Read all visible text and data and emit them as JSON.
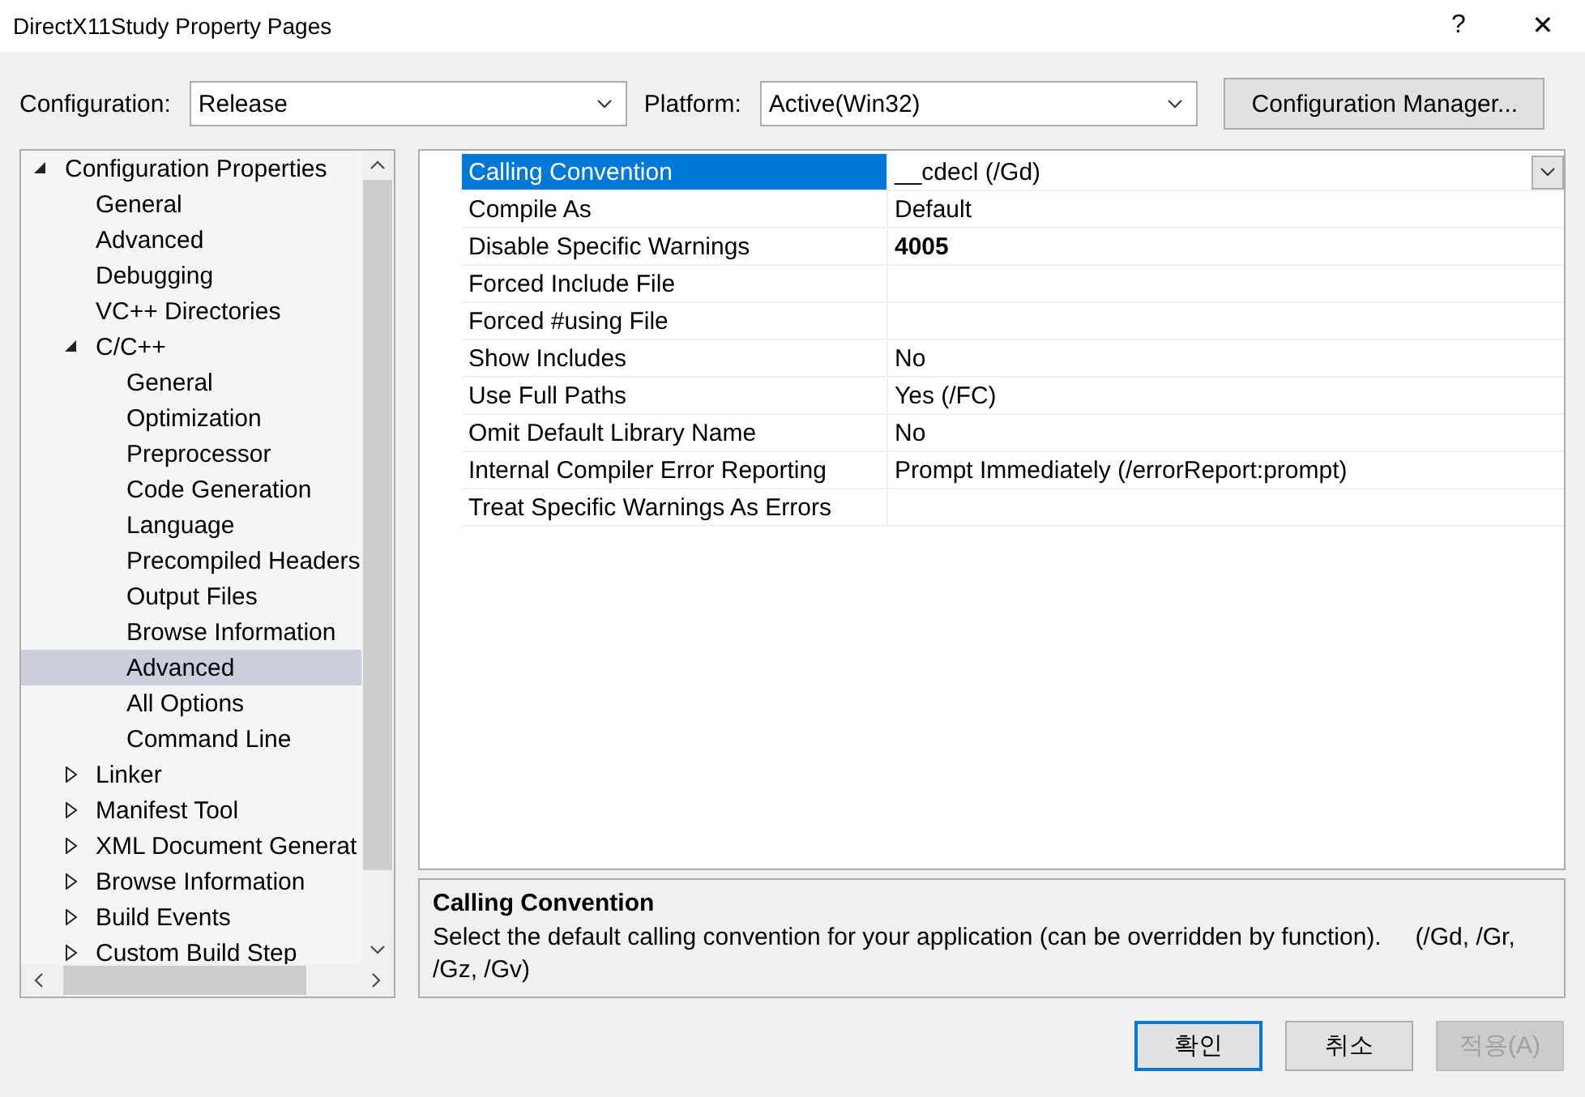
{
  "window": {
    "title": "DirectX11Study Property Pages",
    "help": "?",
    "close": "✕"
  },
  "toolbar": {
    "configuration_label": "Configuration:",
    "configuration": "Release",
    "platform_label": "Platform:",
    "platform": "Active(Win32)",
    "manager_button": "Configuration Manager..."
  },
  "tree": [
    {
      "label": "Configuration Properties",
      "expanded": true,
      "selected": false,
      "children": [
        {
          "label": "General",
          "selected": false
        },
        {
          "label": "Advanced",
          "selected": false
        },
        {
          "label": "Debugging",
          "selected": false
        },
        {
          "label": "VC++ Directories",
          "selected": false
        },
        {
          "label": "C/C++",
          "expanded": true,
          "selected": false,
          "children": [
            {
              "label": "General",
              "selected": false
            },
            {
              "label": "Optimization",
              "selected": false
            },
            {
              "label": "Preprocessor",
              "selected": false
            },
            {
              "label": "Code Generation",
              "selected": false
            },
            {
              "label": "Language",
              "selected": false
            },
            {
              "label": "Precompiled Headers",
              "selected": false
            },
            {
              "label": "Output Files",
              "selected": false
            },
            {
              "label": "Browse Information",
              "selected": false
            },
            {
              "label": "Advanced",
              "selected": true
            },
            {
              "label": "All Options",
              "selected": false
            },
            {
              "label": "Command Line",
              "selected": false
            }
          ]
        },
        {
          "label": "Linker",
          "expanded": false,
          "selected": false
        },
        {
          "label": "Manifest Tool",
          "expanded": false,
          "selected": false
        },
        {
          "label": "XML Document Generat",
          "expanded": false,
          "selected": false
        },
        {
          "label": "Browse Information",
          "expanded": false,
          "selected": false
        },
        {
          "label": "Build Events",
          "expanded": false,
          "selected": false
        },
        {
          "label": "Custom Build Step",
          "expanded": false,
          "selected": false
        }
      ]
    }
  ],
  "properties": [
    {
      "name": "Calling Convention",
      "value": "__cdecl (/Gd)",
      "selected": true,
      "modified": false
    },
    {
      "name": "Compile As",
      "value": "Default",
      "selected": false,
      "modified": false
    },
    {
      "name": "Disable Specific Warnings",
      "value": "4005",
      "selected": false,
      "modified": true
    },
    {
      "name": "Forced Include File",
      "selected": false
    },
    {
      "name": "Forced #using File",
      "selected": false
    },
    {
      "name": "Show Includes",
      "value": "No",
      "selected": false,
      "modified": false
    },
    {
      "name": "Use Full Paths",
      "value": "Yes (/FC)",
      "selected": false,
      "modified": false
    },
    {
      "name": "Omit Default Library Name",
      "value": "No",
      "selected": false,
      "modified": false
    },
    {
      "name": "Internal Compiler Error Reporting",
      "value": "Prompt Immediately (/errorReport:prompt)",
      "selected": false,
      "modified": false
    },
    {
      "name": "Treat Specific Warnings As Errors",
      "selected": false
    }
  ],
  "description": {
    "title": "Calling Convention",
    "text": "Select the default calling convention for your application (can be overridden by function).     (/Gd, /Gr, /Gz, /Gv)"
  },
  "buttons": [
    {
      "label": "확인",
      "default": true,
      "disabled": false
    },
    {
      "label": "취소",
      "default": false,
      "disabled": false
    },
    {
      "label": "적용(A)",
      "default": false,
      "disabled": true
    }
  ]
}
